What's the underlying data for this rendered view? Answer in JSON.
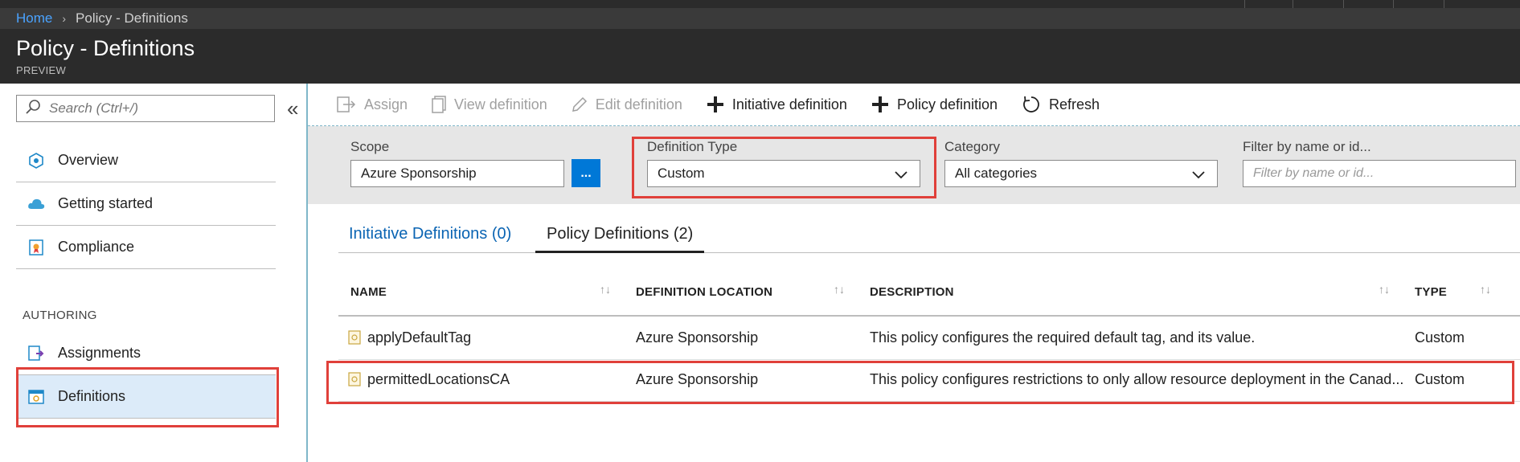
{
  "breadcrumb": {
    "home": "Home",
    "separator": "›",
    "current": "Policy - Definitions"
  },
  "header": {
    "title": "Policy - Definitions",
    "subtitle": "PREVIEW"
  },
  "sidebar": {
    "search_placeholder": "Search (Ctrl+/)",
    "collapse_glyph": "«",
    "items": [
      {
        "label": "Overview",
        "icon": "overview-icon"
      },
      {
        "label": "Getting started",
        "icon": "cloud-icon"
      },
      {
        "label": "Compliance",
        "icon": "compliance-icon"
      }
    ],
    "section_label": "AUTHORING",
    "authoring_items": [
      {
        "label": "Assignments",
        "icon": "assignments-icon"
      },
      {
        "label": "Definitions",
        "icon": "definitions-icon",
        "active": true
      }
    ]
  },
  "toolbar": {
    "assign": "Assign",
    "view_definition": "View definition",
    "edit_definition": "Edit definition",
    "initiative_definition": "Initiative definition",
    "policy_definition": "Policy definition",
    "refresh": "Refresh"
  },
  "filters": {
    "scope_label": "Scope",
    "scope_value": "Azure Sponsorship",
    "scope_button": "...",
    "definition_type_label": "Definition Type",
    "definition_type_value": "Custom",
    "category_label": "Category",
    "category_value": "All categories",
    "filter_label": "Filter by name or id...",
    "filter_placeholder": "Filter by name or id..."
  },
  "tabs": [
    {
      "label": "Initiative Definitions (0)"
    },
    {
      "label": "Policy Definitions (2)",
      "active": true
    }
  ],
  "table": {
    "columns": [
      "NAME",
      "DEFINITION LOCATION",
      "DESCRIPTION",
      "TYPE"
    ],
    "rows": [
      {
        "name": "applyDefaultTag",
        "location": "Azure Sponsorship",
        "description": "This policy configures the required default tag, and its value.",
        "type": "Custom"
      },
      {
        "name": "permittedLocationsCA",
        "location": "Azure Sponsorship",
        "description": "This policy configures restrictions to only allow resource deployment in the Canad...",
        "type": "Custom"
      }
    ]
  },
  "colors": {
    "accent": "#0078d7",
    "highlight": "#e0403a",
    "header_bg": "#2b2b2b",
    "active_nav": "#dcebf9"
  }
}
